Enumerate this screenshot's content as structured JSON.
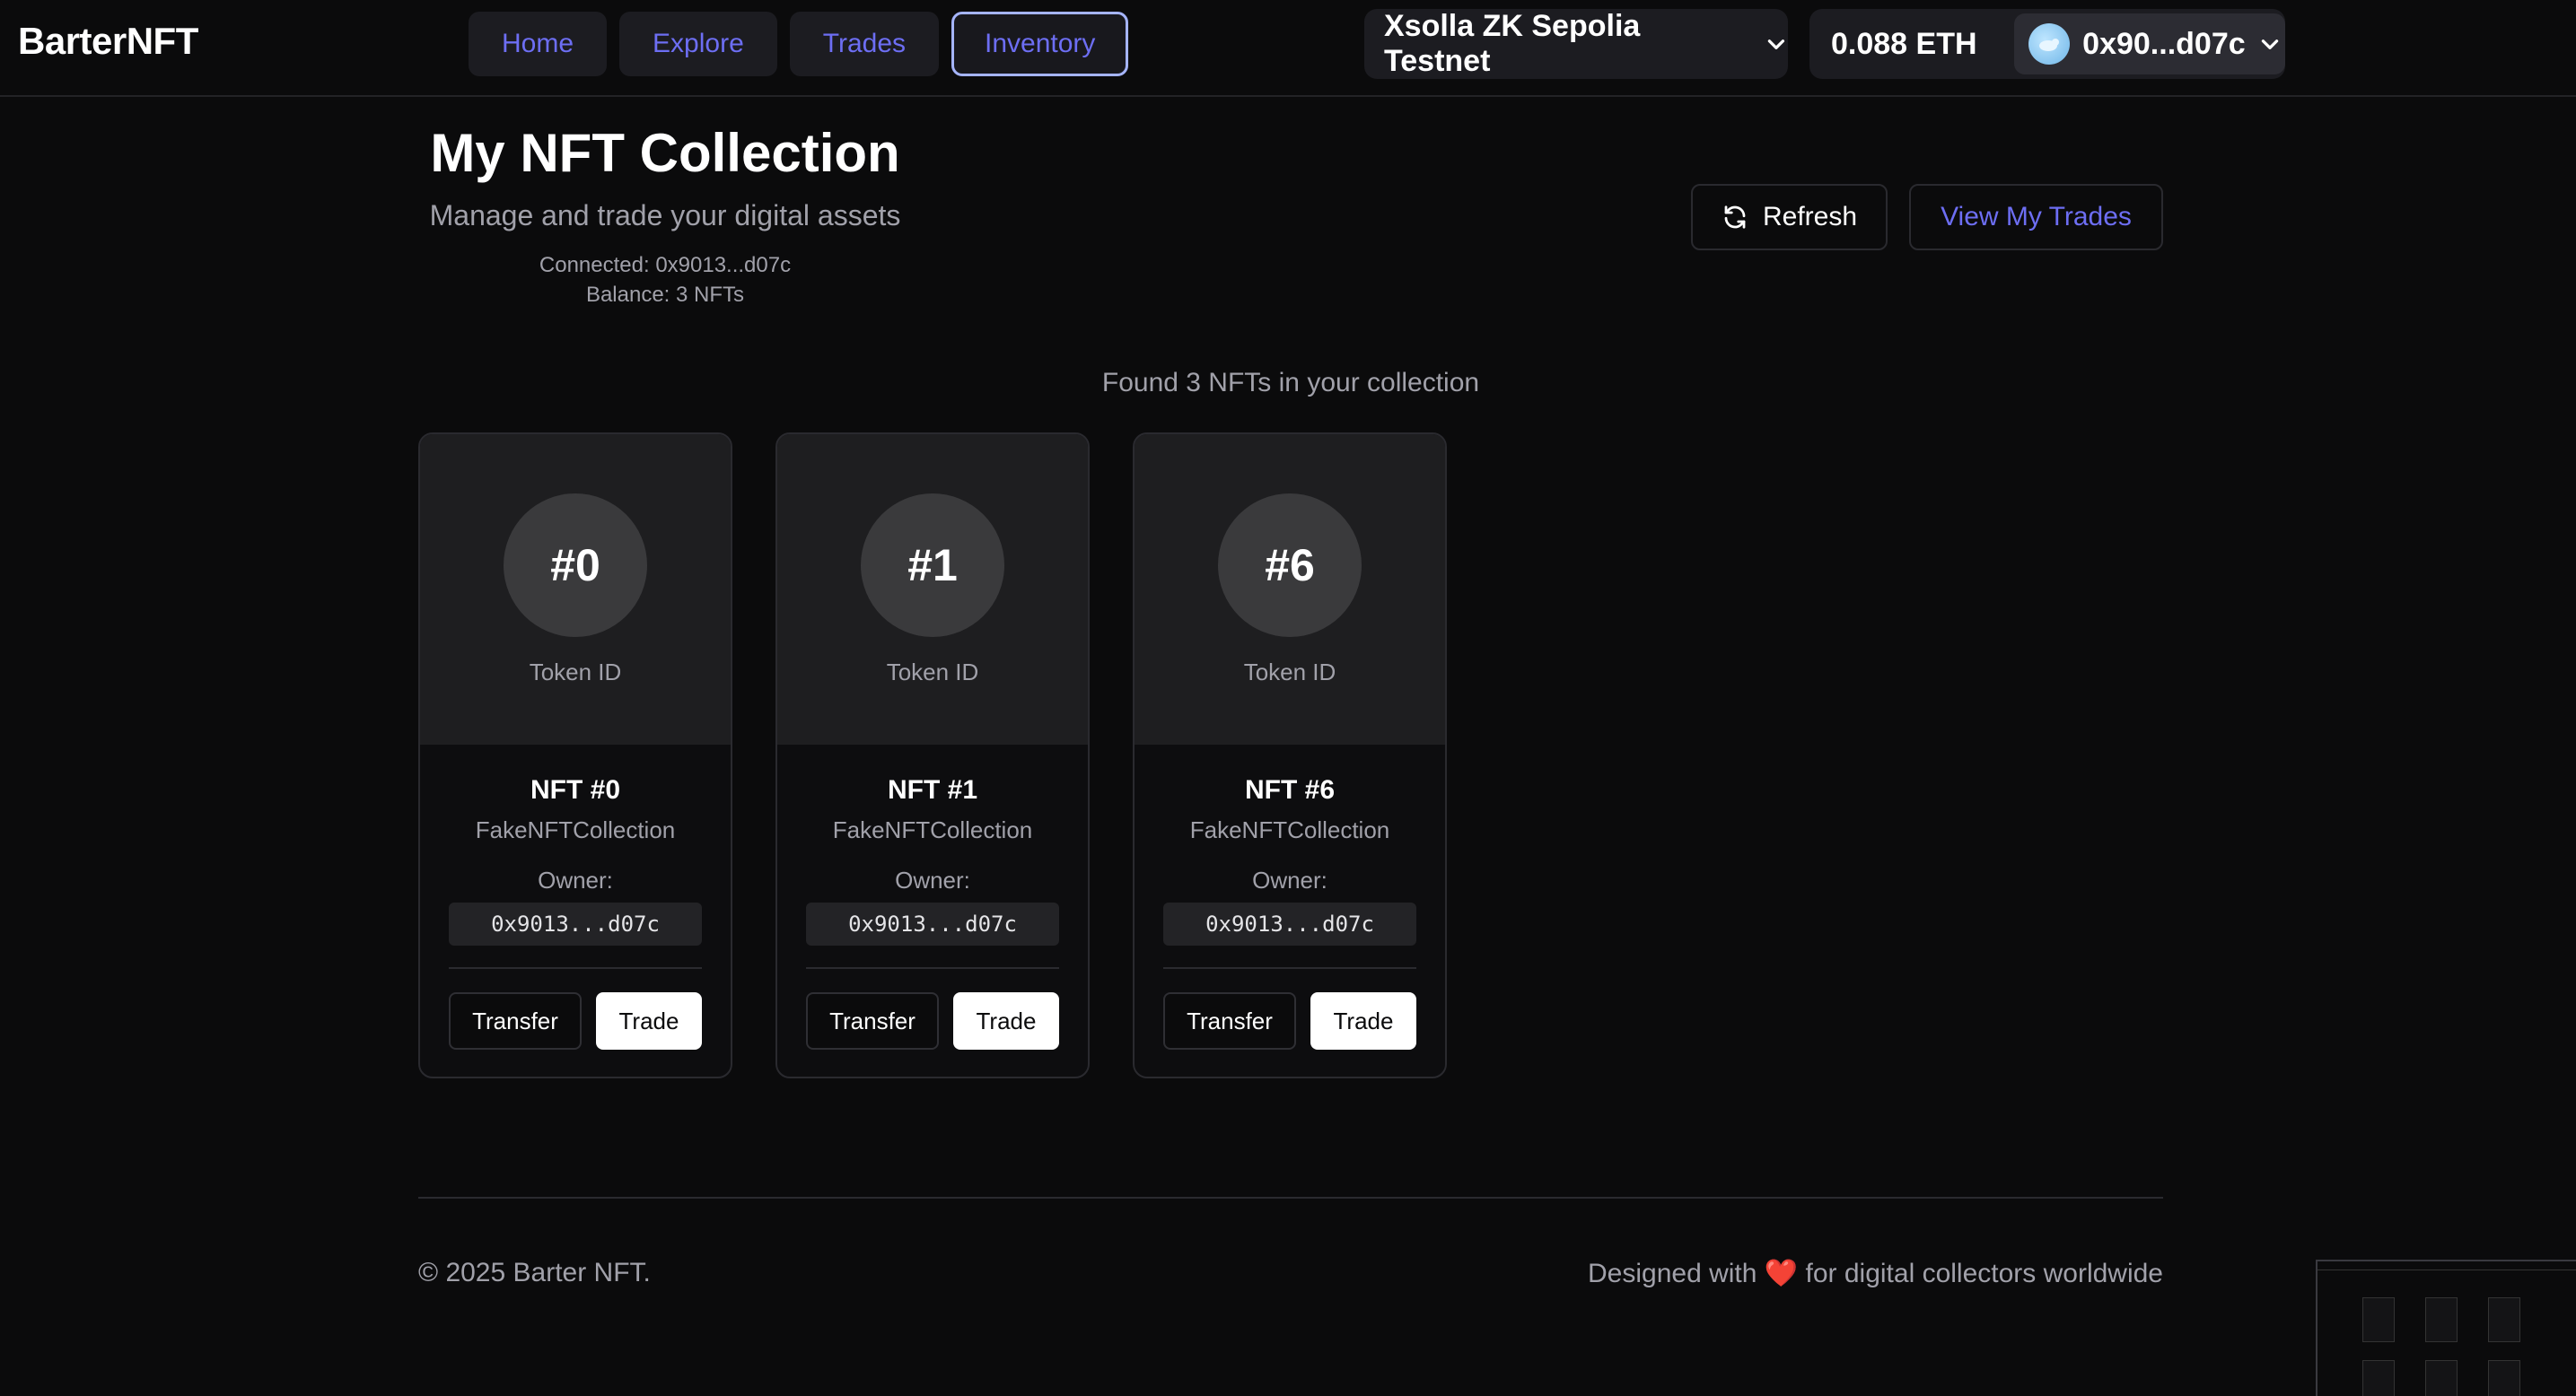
{
  "header": {
    "brand": "BarterNFT",
    "nav": [
      {
        "label": "Home"
      },
      {
        "label": "Explore"
      },
      {
        "label": "Trades"
      },
      {
        "label": "Inventory",
        "active": true
      }
    ],
    "network": "Xsolla ZK Sepolia Testnet",
    "eth_balance": "0.088 ETH",
    "account": "0x90...d07c"
  },
  "page": {
    "title": "My NFT Collection",
    "subtitle": "Manage and trade your digital assets",
    "connected": "Connected: 0x9013...d07c",
    "balance": "Balance: 3 NFTs",
    "refresh_label": "Refresh",
    "view_trades_label": "View My Trades",
    "found_text": "Found 3 NFTs in your collection"
  },
  "nfts": [
    {
      "token": "#0",
      "token_label": "Token ID",
      "name": "NFT #0",
      "collection": "FakeNFTCollection",
      "owner_label": "Owner:",
      "owner": "0x9013...d07c",
      "transfer_label": "Transfer",
      "trade_label": "Trade"
    },
    {
      "token": "#1",
      "token_label": "Token ID",
      "name": "NFT #1",
      "collection": "FakeNFTCollection",
      "owner_label": "Owner:",
      "owner": "0x9013...d07c",
      "transfer_label": "Transfer",
      "trade_label": "Trade"
    },
    {
      "token": "#6",
      "token_label": "Token ID",
      "name": "NFT #6",
      "collection": "FakeNFTCollection",
      "owner_label": "Owner:",
      "owner": "0x9013...d07c",
      "transfer_label": "Transfer",
      "trade_label": "Trade"
    }
  ],
  "footer": {
    "copyright": "© 2025 Barter NFT.",
    "tagline_before": "Designed with",
    "heart": "❤️",
    "tagline_after": "for digital collectors worldwide"
  },
  "icons": {
    "chevron": "chevron-down-icon",
    "refresh": "refresh-icon",
    "avatar": "avatar-icon"
  },
  "colors": {
    "background": "#0b0b0c",
    "accent": "#6d6ef3",
    "active_border": "#a5b4fc",
    "heart": "#ef4444"
  }
}
